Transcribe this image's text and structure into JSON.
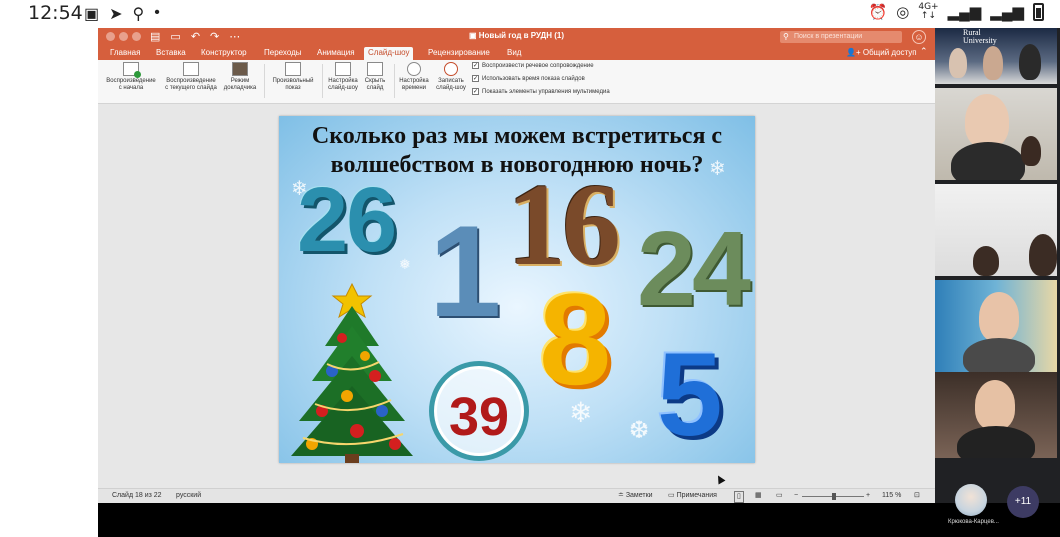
{
  "status_bar": {
    "time": "12:54",
    "net_label_top": "4G+",
    "net_label_bottom": "↑↓"
  },
  "window": {
    "doc_title": "Новый год в РУДН (1)",
    "search_placeholder": "Поиск в презентации",
    "share_label": "Общий доступ"
  },
  "tabs": [
    {
      "label": "Главная"
    },
    {
      "label": "Вставка"
    },
    {
      "label": "Конструктор"
    },
    {
      "label": "Переходы"
    },
    {
      "label": "Анимация"
    },
    {
      "label": "Слайд-шоу"
    },
    {
      "label": "Рецензирование"
    },
    {
      "label": "Вид"
    }
  ],
  "ribbon": {
    "from_start": "Воспроизведение\nс начала",
    "from_current": "Воспроизведение\nс текущего слайда",
    "presenter": "Режим\nдокладчика",
    "custom_show": "Произвольный\nпоказ",
    "setup": "Настройка\nслайд-шоу",
    "hide_slide": "Скрыть\nслайд",
    "rehearse": "Настройка\nвремени",
    "record": "Записать\nслайд-шоу",
    "checkboxes": [
      {
        "label": "Воспроизвести речевое сопровождение"
      },
      {
        "label": "Использовать время показа слайдов"
      },
      {
        "label": "Показать элементы управления мультимедиа"
      }
    ]
  },
  "slide": {
    "title": "Сколько раз мы можем встретиться с волшебством в новогоднюю ночь?",
    "numbers": {
      "n26": "26",
      "n1": "1",
      "n16": "16",
      "n24": "24",
      "n8": "8",
      "n39": "39",
      "n5": "5"
    }
  },
  "ppt_status": {
    "slide_counter": "Слайд 18 из 22",
    "language": "русский",
    "notes": "Заметки",
    "comments": "Примечания",
    "zoom": "115 %"
  },
  "videos": {
    "tile1_text": "Rural\nUniversity"
  },
  "call": {
    "participant_name": "Крюкова-Карцев...",
    "more_count": "+11"
  }
}
